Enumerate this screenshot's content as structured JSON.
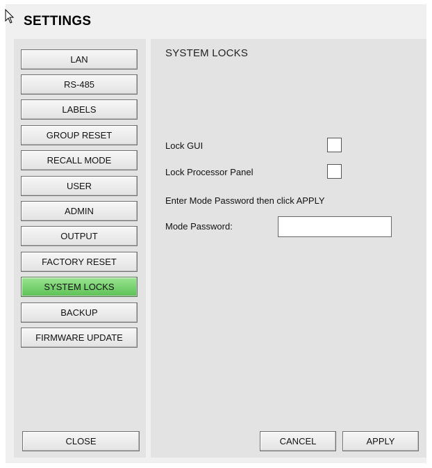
{
  "header": {
    "title": "SETTINGS"
  },
  "sidebar": {
    "items": [
      {
        "label": "LAN",
        "active": false
      },
      {
        "label": "RS-485",
        "active": false
      },
      {
        "label": "LABELS",
        "active": false
      },
      {
        "label": "GROUP RESET",
        "active": false
      },
      {
        "label": "RECALL MODE",
        "active": false
      },
      {
        "label": "USER",
        "active": false
      },
      {
        "label": "ADMIN",
        "active": false
      },
      {
        "label": "OUTPUT",
        "active": false
      },
      {
        "label": "FACTORY RESET",
        "active": false
      },
      {
        "label": "SYSTEM LOCKS",
        "active": true
      },
      {
        "label": "BACKUP",
        "active": false
      },
      {
        "label": "FIRMWARE UPDATE",
        "active": false
      }
    ],
    "close_label": "CLOSE"
  },
  "main": {
    "section_title": "SYSTEM LOCKS",
    "lock_gui_label": "Lock GUI",
    "lock_gui_checked": false,
    "lock_panel_label": "Lock Processor Panel",
    "lock_panel_checked": false,
    "instruction": "Enter Mode Password then click APPLY",
    "password_label": "Mode Password:",
    "password_value": "",
    "cancel_label": "CANCEL",
    "apply_label": "APPLY"
  },
  "colors": {
    "active_tab": "#5cc254",
    "panel_bg": "#e3e3e3",
    "window_bg": "#f0f0f0"
  },
  "icons": {
    "cursor": "arrow-cursor-icon"
  }
}
